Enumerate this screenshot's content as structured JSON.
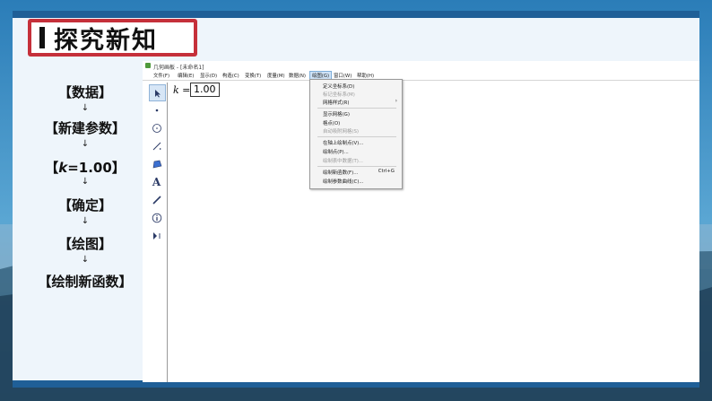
{
  "slide": {
    "title": "探究新知",
    "steps": [
      "【数据】",
      "【新建参数】",
      "=1.00】",
      "【确定】",
      "【绘图】",
      "【绘制新函数】"
    ],
    "step3_prefix": "【",
    "step3_var": "k",
    "arrow": "↓"
  },
  "app": {
    "window_title": "几何画板 - [未命名1]",
    "menus": [
      "文件(F)",
      "编辑(E)",
      "显示(D)",
      "构造(C)",
      "变换(T)",
      "度量(M)",
      "数据(N)",
      "绘图(G)",
      "窗口(W)",
      "帮助(H)"
    ],
    "active_menu": "绘图(G)",
    "param_var": "k",
    "param_eq": " =",
    "param_value": "1.00",
    "dropdown": {
      "items": [
        "定义坐标系(D)",
        "标记坐标系(M)",
        "网格样式(R)",
        "显示网格(G)",
        "格点(O)",
        "自动吸附网格(S)",
        "在轴上绘制点(V)...",
        "绘制点(P)...",
        "绘制表中数据(T)...",
        "绘制新函数(F)...",
        "绘制参数曲线(C)..."
      ],
      "disabled": [
        false,
        true,
        false,
        false,
        false,
        true,
        false,
        false,
        true,
        false,
        false
      ],
      "shortcut": "Ctrl+G"
    },
    "tools": [
      "arrow-select-icon",
      "point-icon",
      "compass-icon",
      "straightedge-icon",
      "polygon-icon",
      "text-icon",
      "marker-icon",
      "info-icon",
      "custom-tool-icon"
    ]
  },
  "colors": {
    "title_border": "#c5303a",
    "frame_strip": "#1f5f97",
    "menu_highlight": "#cfe3f7"
  }
}
